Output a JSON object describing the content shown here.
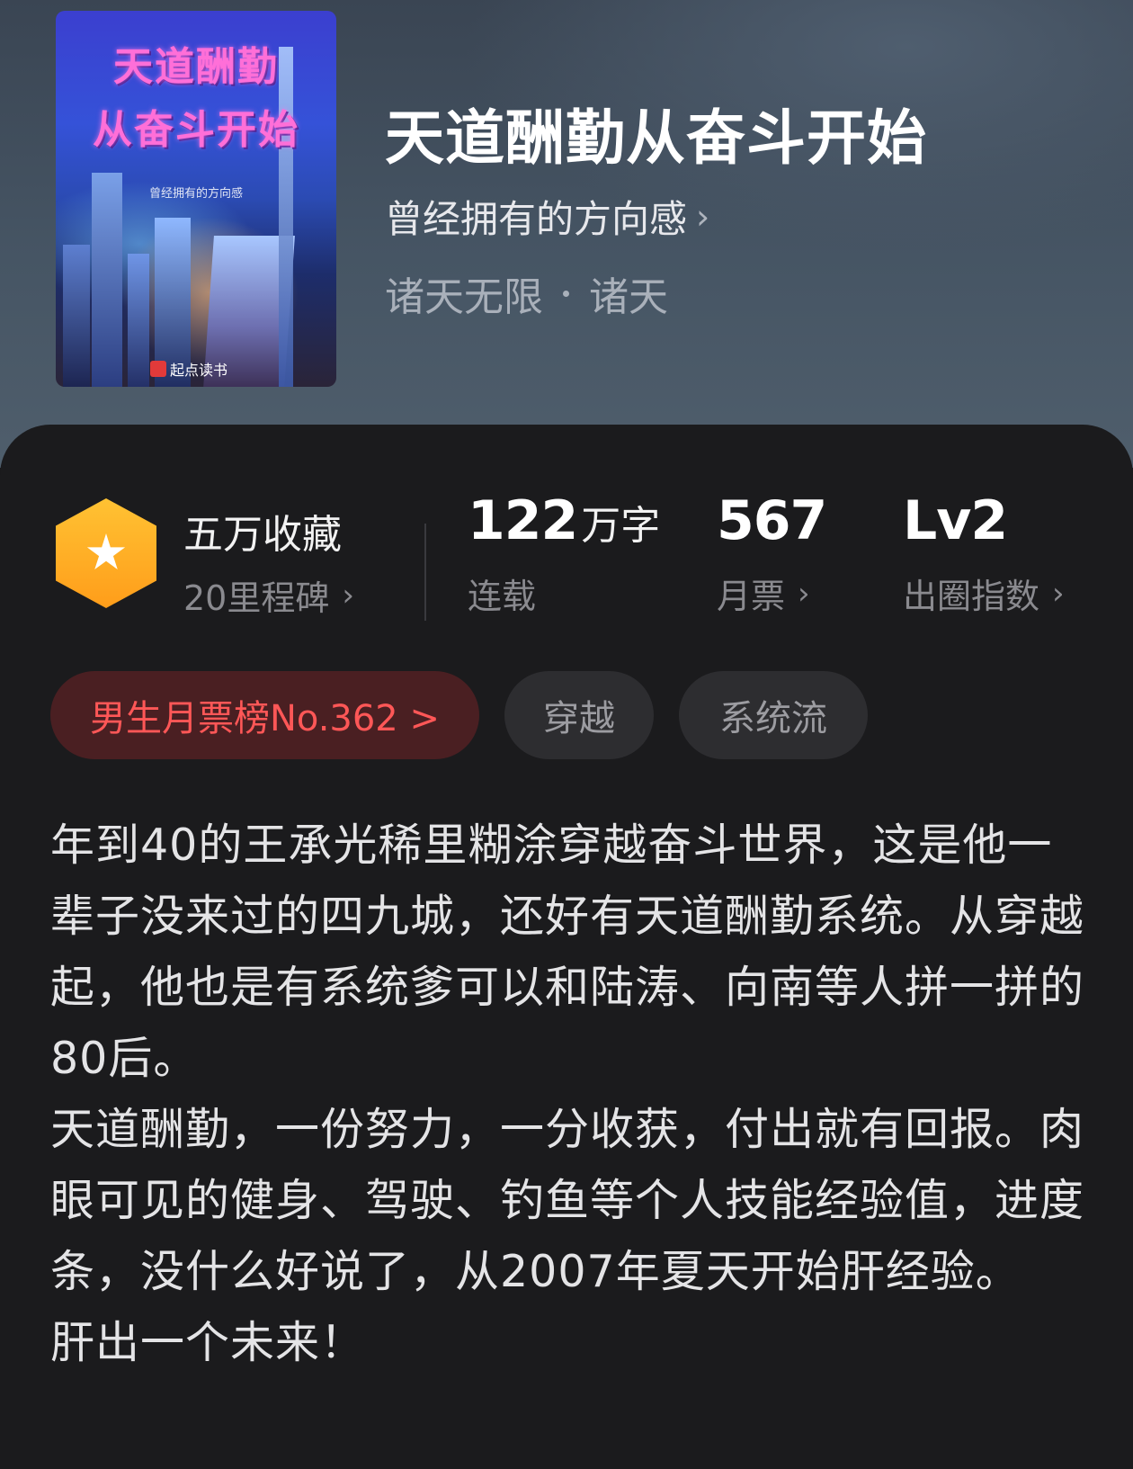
{
  "book": {
    "cover": {
      "title_line1": "天道酬勤",
      "title_line2": "从奋斗开始",
      "author": "曾经拥有的方向感",
      "publisher": "起点读书"
    },
    "title": "天道酬勤从奋斗开始",
    "author": "曾经拥有的方向感",
    "genre": "诸天无限",
    "subgenre": "诸天"
  },
  "stats": {
    "collection_title": "五万收藏",
    "collection_sub": "20里程碑",
    "words_value": "122",
    "words_unit": "万字",
    "words_status": "连载",
    "monthly_votes_value": "567",
    "monthly_votes_label": "月票",
    "influence_value": "Lv2",
    "influence_label": "出圈指数"
  },
  "tags": {
    "rank": "男生月票榜No.362 >",
    "tag1": "穿越",
    "tag2": "系统流"
  },
  "synopsis": {
    "para1": "年到40的王承光稀里糊涂穿越奋斗世界，这是他一辈子没来过的四九城，还好有天道酬勤系统。从穿越起，他也是有系统爹可以和陆涛、向南等人拼一拼的80后。",
    "para2": "天道酬勤，一份努力，一分收获，付出就有回报。肉眼可见的健身、驾驶、钓鱼等个人技能经验值，进度条，没什么好说了，从2007年夏天开始肝经验。",
    "para3": "肝出一个未来！"
  },
  "icons": {
    "milestone": "hexagon-star-icon",
    "chevron": "chevron-right-icon"
  },
  "colors": {
    "accent_orange": "#ffb020",
    "rank_red": "#ff5757",
    "background": "#1b1b1d"
  }
}
